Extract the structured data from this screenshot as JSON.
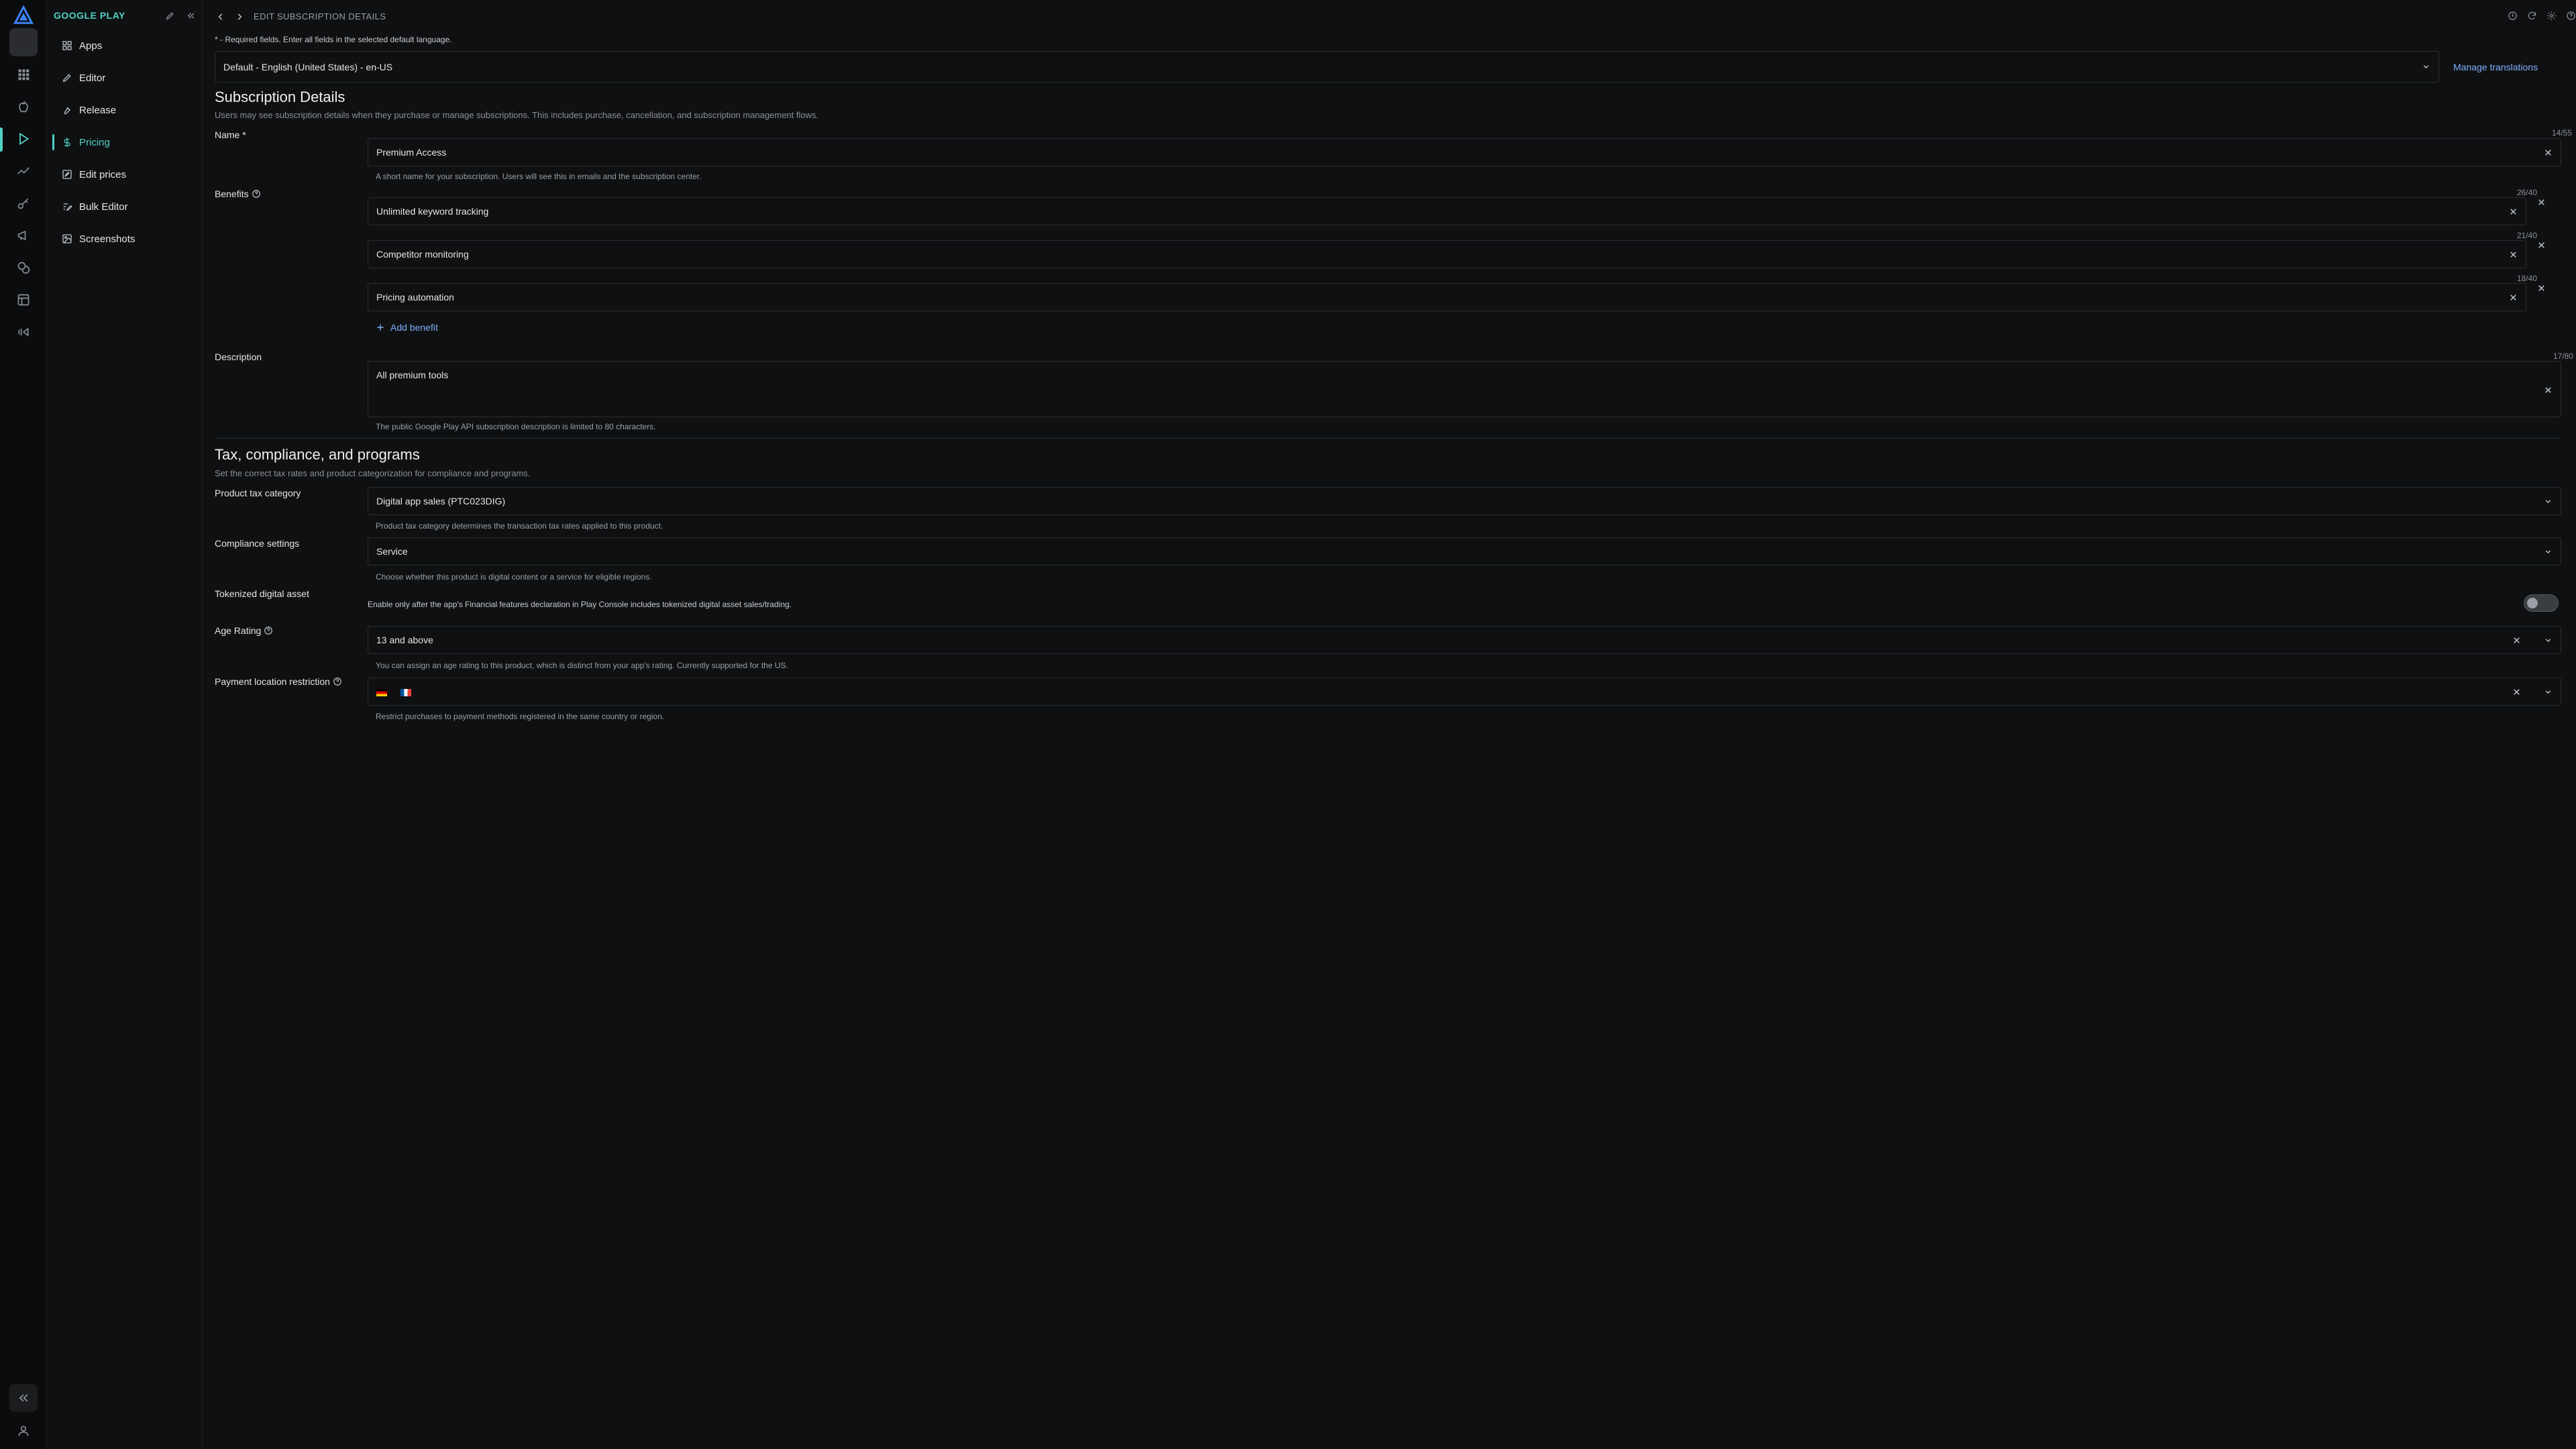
{
  "sidebar": {
    "app_name": "GOOGLE PLAY",
    "items": [
      {
        "label": "Apps",
        "icon": "grid-icon"
      },
      {
        "label": "Editor",
        "icon": "pencil-square-icon"
      },
      {
        "label": "Release",
        "icon": "wrench-icon"
      },
      {
        "label": "Pricing",
        "icon": "dollar-icon",
        "active": true
      },
      {
        "label": "Edit prices",
        "icon": "edit-list-icon"
      },
      {
        "label": "Bulk Editor",
        "icon": "bulk-edit-icon"
      },
      {
        "label": "Screenshots",
        "icon": "image-icon"
      }
    ]
  },
  "header": {
    "title": "EDIT SUBSCRIPTION DETAILS"
  },
  "required_note": "* - Required fields. Enter all fields in the selected default language.",
  "language": {
    "selected": "Default - English (United States) - en-US",
    "manage_link": "Manage translations"
  },
  "subscription": {
    "title": "Subscription Details",
    "subtitle": "Users may see subscription details when they purchase or manage subscriptions. This includes purchase, cancellation, and subscription management flows.",
    "name_label": "Name *",
    "name_value": "Premium Access",
    "name_counter": "14/55",
    "name_help": "A short name for your subscription. Users will see this in emails and the subscription center.",
    "benefits_label": "Benefits",
    "benefits": [
      {
        "value": "Unlimited keyword tracking",
        "counter": "26/40"
      },
      {
        "value": "Competitor monitoring",
        "counter": "21/40"
      },
      {
        "value": "Pricing automation",
        "counter": "18/40"
      }
    ],
    "add_benefit": "Add benefit",
    "description_label": "Description",
    "description_value": "All premium tools",
    "description_counter": "17/80",
    "description_help": "The public Google Play API subscription description is limited to 80 characters."
  },
  "tax": {
    "title": "Tax, compliance, and programs",
    "subtitle": "Set the correct tax rates and product categorization for compliance and programs.",
    "category_label": "Product tax category",
    "category_value": "Digital app sales (PTC023DIG)",
    "category_help": "Product tax category determines the transaction tax rates applied to this product.",
    "compliance_label": "Compliance settings",
    "compliance_value": "Service",
    "compliance_help": "Choose whether this product is digital content or a service for eligible regions.",
    "tokenized_label": "Tokenized digital asset",
    "tokenized_help": "Enable only after the app's Financial features declaration in Play Console includes tokenized digital asset sales/trading.",
    "tokenized_enabled": false,
    "age_label": "Age Rating",
    "age_value": "13 and above",
    "age_help": "You can assign an age rating to this product, which is distinct from your app's rating. Currently supported for the US.",
    "payment_label": "Payment location restriction",
    "payment_flags": [
      "germany-flag",
      "france-flag"
    ],
    "payment_help": "Restrict purchases to payment methods registered in the same country or region."
  },
  "colors": {
    "accent": "#4fd1c5",
    "link": "#7fb0ff",
    "background": "#0f1011"
  }
}
